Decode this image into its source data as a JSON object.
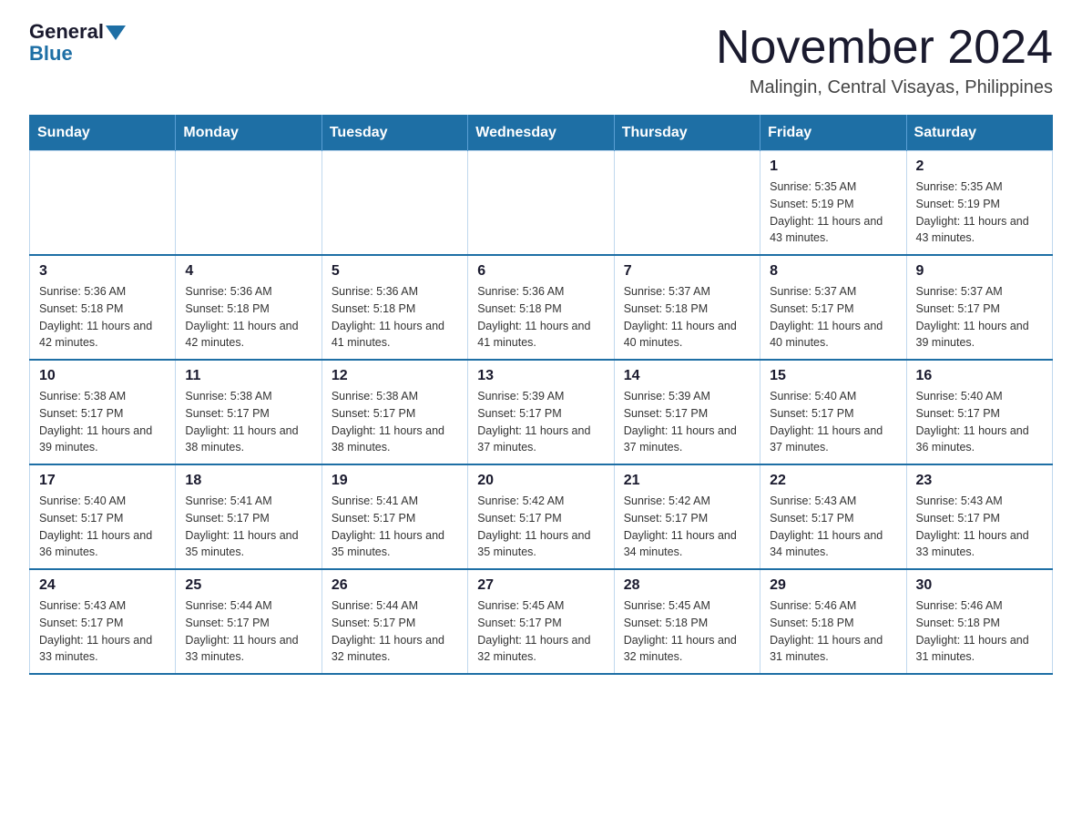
{
  "header": {
    "logo_general": "General",
    "logo_blue": "Blue",
    "month_title": "November 2024",
    "location": "Malingin, Central Visayas, Philippines"
  },
  "calendar": {
    "days_of_week": [
      "Sunday",
      "Monday",
      "Tuesday",
      "Wednesday",
      "Thursday",
      "Friday",
      "Saturday"
    ],
    "weeks": [
      [
        {
          "day": "",
          "info": ""
        },
        {
          "day": "",
          "info": ""
        },
        {
          "day": "",
          "info": ""
        },
        {
          "day": "",
          "info": ""
        },
        {
          "day": "",
          "info": ""
        },
        {
          "day": "1",
          "info": "Sunrise: 5:35 AM\nSunset: 5:19 PM\nDaylight: 11 hours and 43 minutes."
        },
        {
          "day": "2",
          "info": "Sunrise: 5:35 AM\nSunset: 5:19 PM\nDaylight: 11 hours and 43 minutes."
        }
      ],
      [
        {
          "day": "3",
          "info": "Sunrise: 5:36 AM\nSunset: 5:18 PM\nDaylight: 11 hours and 42 minutes."
        },
        {
          "day": "4",
          "info": "Sunrise: 5:36 AM\nSunset: 5:18 PM\nDaylight: 11 hours and 42 minutes."
        },
        {
          "day": "5",
          "info": "Sunrise: 5:36 AM\nSunset: 5:18 PM\nDaylight: 11 hours and 41 minutes."
        },
        {
          "day": "6",
          "info": "Sunrise: 5:36 AM\nSunset: 5:18 PM\nDaylight: 11 hours and 41 minutes."
        },
        {
          "day": "7",
          "info": "Sunrise: 5:37 AM\nSunset: 5:18 PM\nDaylight: 11 hours and 40 minutes."
        },
        {
          "day": "8",
          "info": "Sunrise: 5:37 AM\nSunset: 5:17 PM\nDaylight: 11 hours and 40 minutes."
        },
        {
          "day": "9",
          "info": "Sunrise: 5:37 AM\nSunset: 5:17 PM\nDaylight: 11 hours and 39 minutes."
        }
      ],
      [
        {
          "day": "10",
          "info": "Sunrise: 5:38 AM\nSunset: 5:17 PM\nDaylight: 11 hours and 39 minutes."
        },
        {
          "day": "11",
          "info": "Sunrise: 5:38 AM\nSunset: 5:17 PM\nDaylight: 11 hours and 38 minutes."
        },
        {
          "day": "12",
          "info": "Sunrise: 5:38 AM\nSunset: 5:17 PM\nDaylight: 11 hours and 38 minutes."
        },
        {
          "day": "13",
          "info": "Sunrise: 5:39 AM\nSunset: 5:17 PM\nDaylight: 11 hours and 37 minutes."
        },
        {
          "day": "14",
          "info": "Sunrise: 5:39 AM\nSunset: 5:17 PM\nDaylight: 11 hours and 37 minutes."
        },
        {
          "day": "15",
          "info": "Sunrise: 5:40 AM\nSunset: 5:17 PM\nDaylight: 11 hours and 37 minutes."
        },
        {
          "day": "16",
          "info": "Sunrise: 5:40 AM\nSunset: 5:17 PM\nDaylight: 11 hours and 36 minutes."
        }
      ],
      [
        {
          "day": "17",
          "info": "Sunrise: 5:40 AM\nSunset: 5:17 PM\nDaylight: 11 hours and 36 minutes."
        },
        {
          "day": "18",
          "info": "Sunrise: 5:41 AM\nSunset: 5:17 PM\nDaylight: 11 hours and 35 minutes."
        },
        {
          "day": "19",
          "info": "Sunrise: 5:41 AM\nSunset: 5:17 PM\nDaylight: 11 hours and 35 minutes."
        },
        {
          "day": "20",
          "info": "Sunrise: 5:42 AM\nSunset: 5:17 PM\nDaylight: 11 hours and 35 minutes."
        },
        {
          "day": "21",
          "info": "Sunrise: 5:42 AM\nSunset: 5:17 PM\nDaylight: 11 hours and 34 minutes."
        },
        {
          "day": "22",
          "info": "Sunrise: 5:43 AM\nSunset: 5:17 PM\nDaylight: 11 hours and 34 minutes."
        },
        {
          "day": "23",
          "info": "Sunrise: 5:43 AM\nSunset: 5:17 PM\nDaylight: 11 hours and 33 minutes."
        }
      ],
      [
        {
          "day": "24",
          "info": "Sunrise: 5:43 AM\nSunset: 5:17 PM\nDaylight: 11 hours and 33 minutes."
        },
        {
          "day": "25",
          "info": "Sunrise: 5:44 AM\nSunset: 5:17 PM\nDaylight: 11 hours and 33 minutes."
        },
        {
          "day": "26",
          "info": "Sunrise: 5:44 AM\nSunset: 5:17 PM\nDaylight: 11 hours and 32 minutes."
        },
        {
          "day": "27",
          "info": "Sunrise: 5:45 AM\nSunset: 5:17 PM\nDaylight: 11 hours and 32 minutes."
        },
        {
          "day": "28",
          "info": "Sunrise: 5:45 AM\nSunset: 5:18 PM\nDaylight: 11 hours and 32 minutes."
        },
        {
          "day": "29",
          "info": "Sunrise: 5:46 AM\nSunset: 5:18 PM\nDaylight: 11 hours and 31 minutes."
        },
        {
          "day": "30",
          "info": "Sunrise: 5:46 AM\nSunset: 5:18 PM\nDaylight: 11 hours and 31 minutes."
        }
      ]
    ]
  }
}
